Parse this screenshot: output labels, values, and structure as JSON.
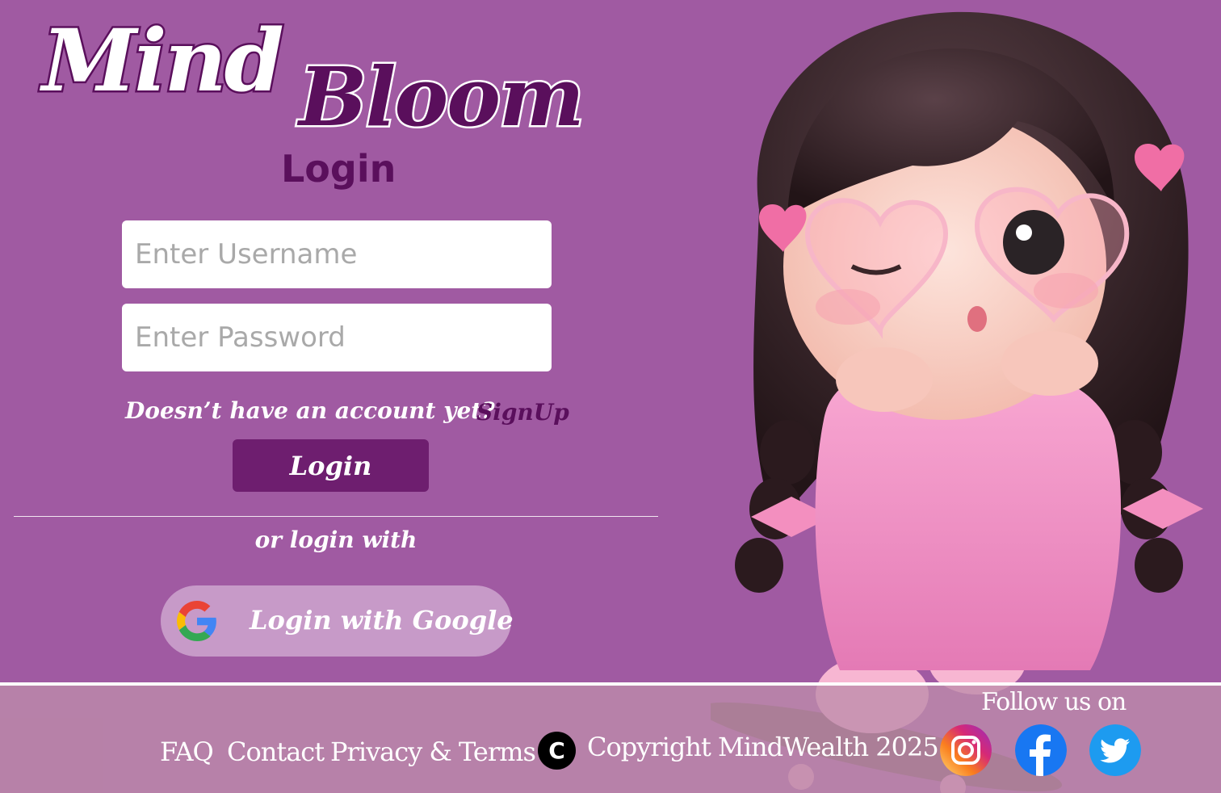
{
  "brand": {
    "part1": "Mind",
    "part2": "Bloom"
  },
  "form": {
    "title": "Login",
    "username_placeholder": "Enter Username",
    "password_placeholder": "Enter Password",
    "signup_prompt": "Doesn’t have an account yet?",
    "signup_link": "SignUp",
    "login_button": "Login",
    "alt_login_text": "or login with",
    "google_button": "Login with Google"
  },
  "footer": {
    "links": [
      "FAQ",
      "Contact",
      "Privacy & Terms"
    ],
    "copyright_symbol": "C",
    "copyright_text": "Copyright MindWealth 2025",
    "follow_text": "Follow us on",
    "socials": [
      "instagram-icon",
      "facebook-icon",
      "twitter-icon"
    ]
  },
  "colors": {
    "background": "#a05aa2",
    "brand_dark": "#5a0f5c",
    "button": "#6e1e6f",
    "google_button": "#c79ac8"
  }
}
